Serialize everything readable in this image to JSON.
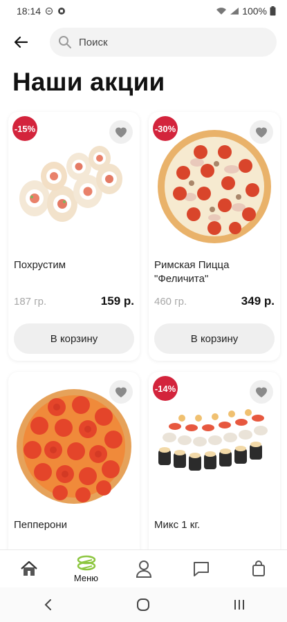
{
  "status_bar": {
    "time": "18:14",
    "battery": "100%"
  },
  "search": {
    "placeholder": "Поиск"
  },
  "page": {
    "title": "Наши акции"
  },
  "products": [
    {
      "name": "Похрустим",
      "discount": "-15%",
      "weight": "187 гр.",
      "price": "159 р.",
      "button": "В корзину",
      "image": "sushi-rolls"
    },
    {
      "name": "Римская Пицца \"Феличита\"",
      "discount": "-30%",
      "weight": "460 гр.",
      "price": "349 р.",
      "button": "В корзину",
      "image": "pizza-felichita"
    },
    {
      "name": "Пепперони",
      "discount": "",
      "weight": "",
      "price": "",
      "button": "",
      "image": "pizza-pepperoni"
    },
    {
      "name": "Микс 1 кг.",
      "discount": "-14%",
      "weight": "",
      "price": "",
      "button": "",
      "image": "sushi-mix"
    }
  ],
  "bottom_nav": {
    "items": [
      {
        "icon": "home-icon",
        "label": ""
      },
      {
        "icon": "menu-icon",
        "label": "Меню"
      },
      {
        "icon": "profile-icon",
        "label": ""
      },
      {
        "icon": "chat-icon",
        "label": ""
      },
      {
        "icon": "bag-icon",
        "label": ""
      }
    ],
    "active_color": "#8cc63f"
  },
  "colors": {
    "badge": "#d3243c",
    "button_bg": "#efefef",
    "accent": "#8cc63f"
  }
}
